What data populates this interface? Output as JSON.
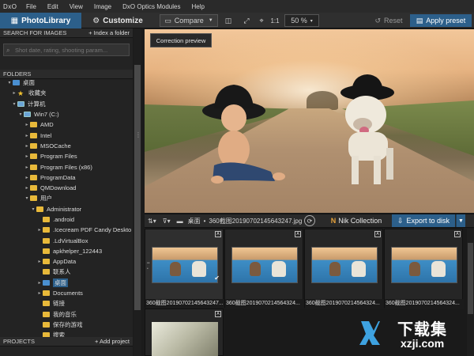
{
  "menubar": {
    "logo": "DxO",
    "items": [
      "File",
      "Edit",
      "View",
      "Image",
      "DxO Optics Modules",
      "Help"
    ]
  },
  "toolbar": {
    "photolibrary": "PhotoLibrary",
    "customize": "Customize",
    "compare": "Compare",
    "one_to_one": "1:1",
    "zoom": "50 %",
    "reset": "Reset",
    "apply_preset": "Apply preset"
  },
  "search": {
    "header": "SEARCH FOR IMAGES",
    "action": "+ Index a folder",
    "placeholder": "Shot date, rating, shooting param..."
  },
  "folders": {
    "header": "FOLDERS",
    "tree": [
      {
        "label": "桌面",
        "arrow": "▾",
        "icon": "desktop"
      },
      {
        "label": "收藏夹",
        "arrow": "▸",
        "icon": "star"
      },
      {
        "label": "计算机",
        "arrow": "▾",
        "icon": "computer"
      },
      {
        "label": "Win7 (C:)",
        "arrow": "▾",
        "icon": "drive"
      },
      {
        "label": "AMD",
        "arrow": "▸",
        "icon": "folder"
      },
      {
        "label": "Intel",
        "arrow": "▸",
        "icon": "folder"
      },
      {
        "label": "MSOCache",
        "arrow": "▸",
        "icon": "folder"
      },
      {
        "label": "Program Files",
        "arrow": "▸",
        "icon": "folder"
      },
      {
        "label": "Program Files (x86)",
        "arrow": "▸",
        "icon": "folder"
      },
      {
        "label": "ProgramData",
        "arrow": "▸",
        "icon": "folder"
      },
      {
        "label": "QMDownload",
        "arrow": "▸",
        "icon": "folder"
      },
      {
        "label": "用户",
        "arrow": "▾",
        "icon": "folder"
      },
      {
        "label": "Administrator",
        "arrow": "▾",
        "icon": "folder"
      },
      {
        "label": ".android",
        "arrow": "",
        "icon": "folder"
      },
      {
        "label": ".Icecream PDF Candy Deskto",
        "arrow": "▸",
        "icon": "folder"
      },
      {
        "label": ".LdVirtualBox",
        "arrow": "",
        "icon": "folder"
      },
      {
        "label": "apkhelper_122443",
        "arrow": "",
        "icon": "folder"
      },
      {
        "label": "AppData",
        "arrow": "▸",
        "icon": "folder"
      },
      {
        "label": "联系人",
        "arrow": "",
        "icon": "folder"
      },
      {
        "label": "桌面",
        "arrow": "▸",
        "icon": "desktop"
      },
      {
        "label": "Documents",
        "arrow": "▸",
        "icon": "folder"
      },
      {
        "label": "链接",
        "arrow": "",
        "icon": "folder"
      },
      {
        "label": "我的音乐",
        "arrow": "",
        "icon": "folder"
      },
      {
        "label": "保存的游戏",
        "arrow": "",
        "icon": "folder"
      },
      {
        "label": "搜索",
        "arrow": "",
        "icon": "folder"
      }
    ]
  },
  "projects": {
    "header": "PROJECTS",
    "action": "+ Add project"
  },
  "preview": {
    "label": "Correction preview"
  },
  "filmstrip_toolbar": {
    "location": "桌面",
    "separator": "•",
    "filename": "360截图20190702145643247.jpg",
    "nik": "Nik Collection",
    "nik_letter": "N",
    "export": "Export to disk"
  },
  "thumbnails": [
    {
      "caption": "360截图20190702145643247..."
    },
    {
      "caption": "360截图201907021456432​4..."
    },
    {
      "caption": "360截图201907021456432​4..."
    },
    {
      "caption": "360截图201907021456432​4..."
    }
  ],
  "watermark": {
    "cn": "下载集",
    "url": "xzji.com"
  }
}
